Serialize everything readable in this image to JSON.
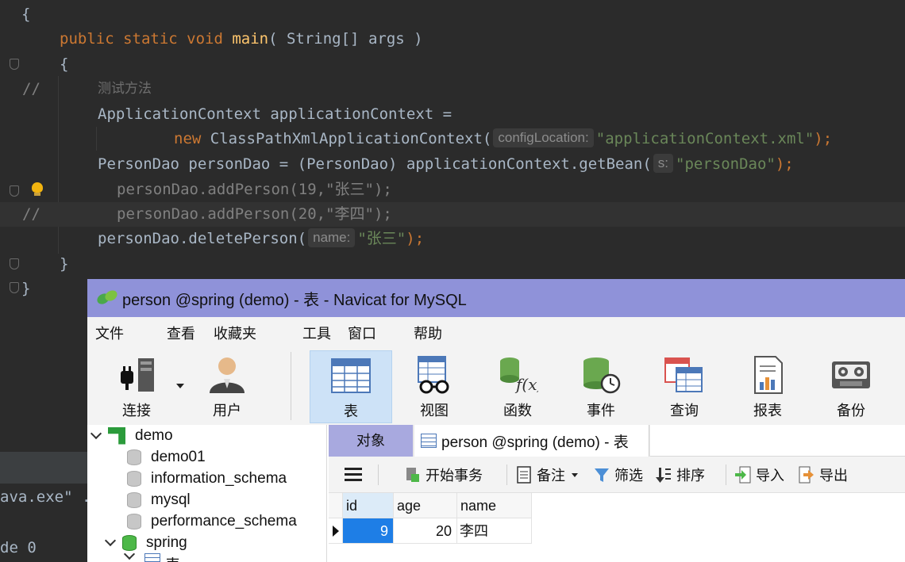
{
  "editor": {
    "lines": {
      "open_brace": "{",
      "main_decl": {
        "kw": "public static void ",
        "fn": "main",
        "rest": "( String[] args )"
      },
      "main_open": "{",
      "comment_marker": "//",
      "comment_text": "测试方法",
      "ctx_decl": "ApplicationContext applicationContext =",
      "ctx_new": {
        "kw": "new",
        "rest": " ClassPathXmlApplicationContext(",
        "hint": "configLocation:",
        "str": "\"applicationContext.xml\"",
        "end": ");"
      },
      "dao_decl": {
        "pre": "PersonDao personDao = (PersonDao) applicationContext.getBean(",
        "hint": "s:",
        "str": "\"personDao\"",
        "end": ");"
      },
      "add1": "personDao.addPerson(19,\"张三\");",
      "add2": "personDao.addPerson(20,\"李四\");",
      "add_comment_marker": "//",
      "delete": {
        "pre": "personDao.deletePerson(",
        "hint": "name:",
        "str": "\"张三\"",
        "end": ");"
      },
      "main_close": "}",
      "class_close": "}"
    },
    "run": {
      "exe_text": "ava.exe\" .",
      "exit_text": "de 0"
    }
  },
  "navicat": {
    "title": "person @spring (demo) - 表 - Navicat for MySQL",
    "menu": [
      "文件",
      "查看",
      "收藏夹",
      "工具",
      "窗口",
      "帮助"
    ],
    "toolbar": {
      "connect": "连接",
      "user": "用户",
      "table": "表",
      "view": "视图",
      "function": "函数",
      "event": "事件",
      "query": "查询",
      "report": "报表",
      "backup": "备份"
    },
    "tree": {
      "connection": "demo",
      "databases": [
        "demo01",
        "information_schema",
        "mysql",
        "performance_schema",
        "spring"
      ],
      "partial_child": "表"
    },
    "tabs": {
      "objects": "对象",
      "table_tab": "person @spring (demo) - 表"
    },
    "objbar": {
      "begin_tx": "开始事务",
      "note": "备注",
      "filter": "筛选",
      "sort": "排序",
      "import": "导入",
      "export": "导出"
    },
    "grid": {
      "columns": [
        "id",
        "age",
        "name"
      ],
      "rows": [
        {
          "id": "9",
          "age": "20",
          "name": "李四"
        }
      ]
    },
    "colors": {
      "title_bar": "#8f92d9",
      "objects_tab": "#a8a9df",
      "selected_cell": "#1e7ee6"
    }
  }
}
